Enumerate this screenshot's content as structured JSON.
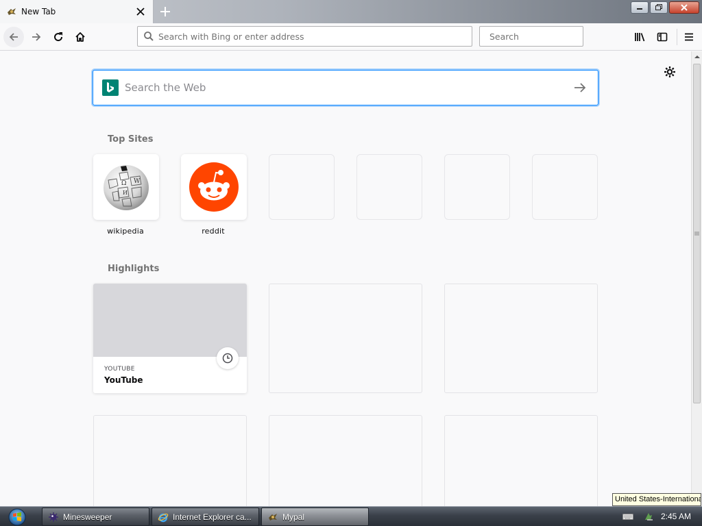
{
  "window": {
    "tab_title": "New Tab",
    "controls": {
      "minimize": "minimize-icon",
      "restore": "restore-icon",
      "close": "close-icon"
    }
  },
  "toolbar": {
    "url_placeholder": "Search with Bing or enter address",
    "search_placeholder": "Search",
    "icons": [
      "back-icon",
      "forward-icon",
      "reload-icon",
      "home-icon",
      "library-icon",
      "sidebar-icon",
      "menu-icon"
    ]
  },
  "newtab": {
    "websearch_placeholder": "Search the Web",
    "top_sites_title": "Top Sites",
    "top_sites": [
      {
        "label": "wikipedia",
        "icon": "wikipedia-globe-icon"
      },
      {
        "label": "reddit",
        "icon": "reddit-icon"
      }
    ],
    "highlights_title": "Highlights",
    "highlights": [
      {
        "hostname": "YOUTUBE",
        "title": "YouTube",
        "icon": "clock-icon"
      }
    ],
    "colors": {
      "focus_ring": "#0a84ff",
      "bing": "#008373",
      "reddit": "#ff4500"
    }
  },
  "language_tooltip": "United States-International",
  "taskbar": {
    "items": [
      {
        "label": "Minesweeper"
      },
      {
        "label": "Internet Explorer ca..."
      },
      {
        "label": "Mypal"
      }
    ],
    "clock": "2:45 AM"
  }
}
